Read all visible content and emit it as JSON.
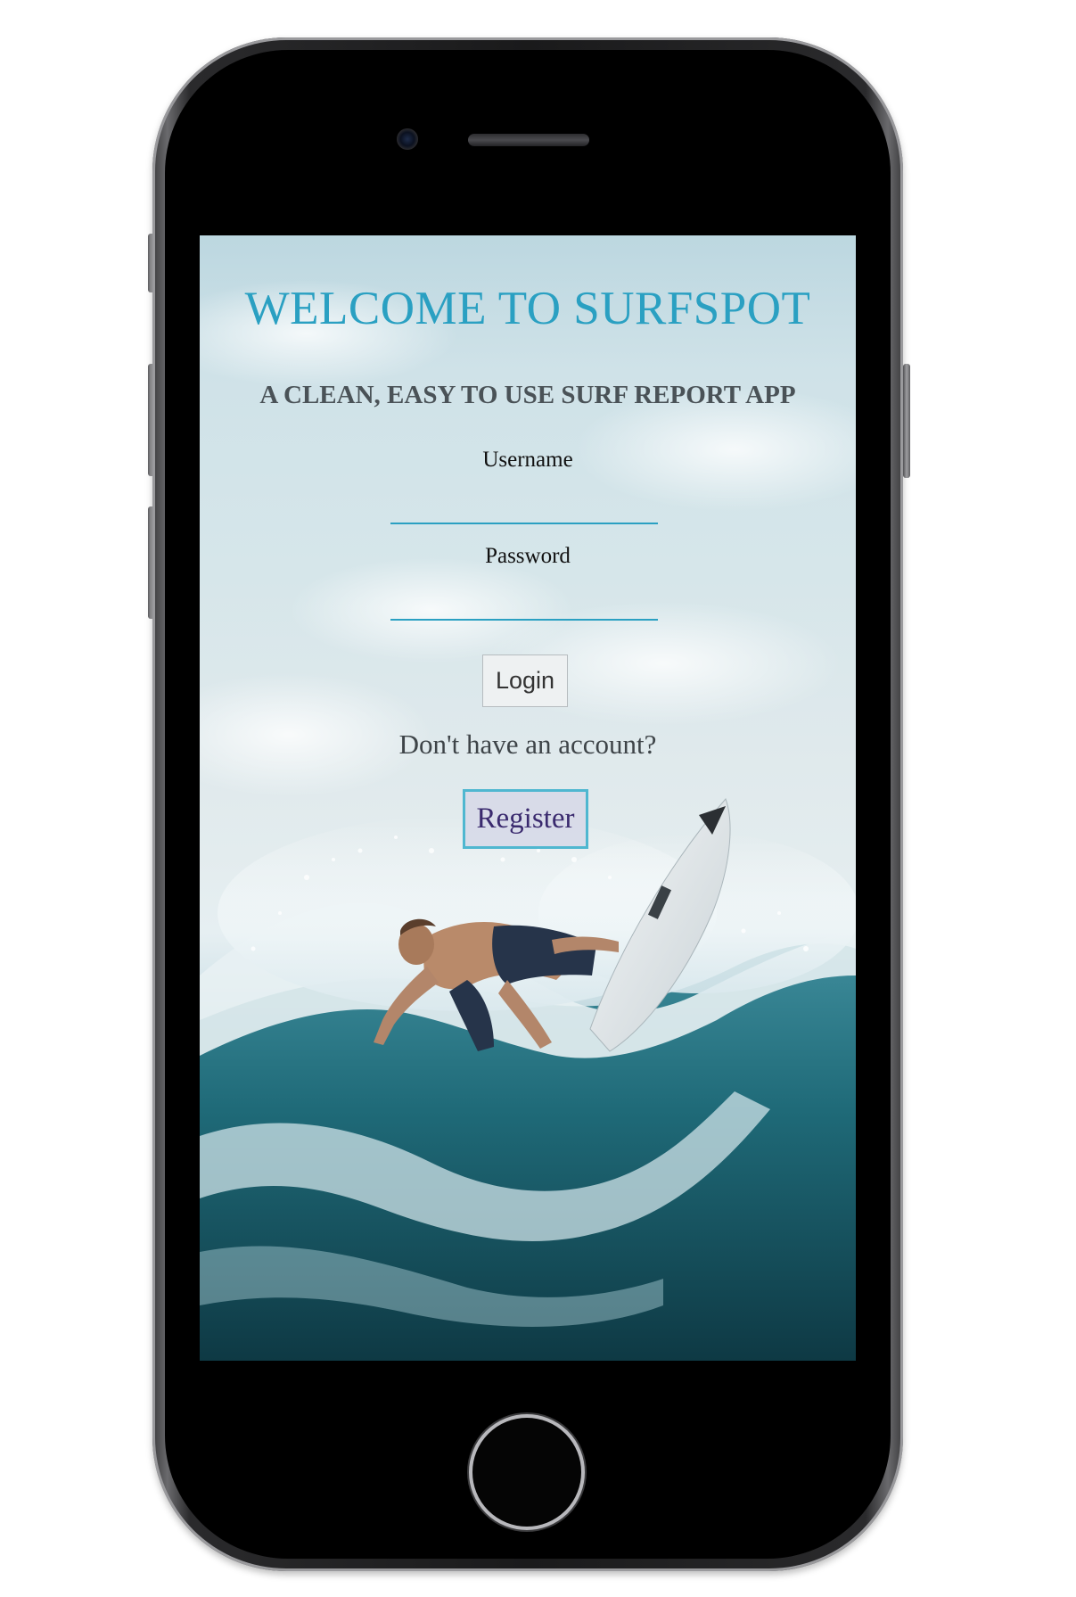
{
  "app": {
    "title": "WELCOME TO SURFSPOT",
    "subtitle": "A CLEAN, EASY TO USE SURF REPORT APP"
  },
  "form": {
    "username_label": "Username",
    "username_value": "",
    "password_label": "Password",
    "password_value": "",
    "login_label": "Login",
    "no_account_text": "Don't have an account?",
    "register_label": "Register"
  },
  "colors": {
    "accent": "#2aa0c2",
    "register_border": "#4fb7d0",
    "register_text": "#3a2a6e",
    "subtitle_text": "#4a5257"
  },
  "background": {
    "image": "surfer-on-wave-photo"
  },
  "device": {
    "type": "smartphone-frame"
  }
}
